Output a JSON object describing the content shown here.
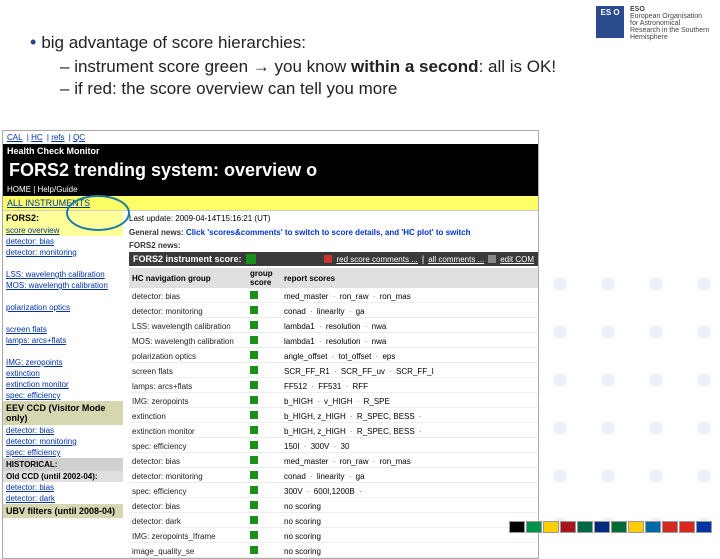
{
  "logo": {
    "badge": "ES O",
    "org": "ESO",
    "tag": "European Organisation for Astronomical Research in the Southern Hemisphere"
  },
  "bullets": {
    "l1": "big advantage of score hierarchies:",
    "l2a_pre": "instrument score green ",
    "l2a_arrow": "→",
    "l2a_mid": " you know ",
    "l2a_bold": "within a second",
    "l2a_post": ": all is OK!",
    "l2b": "if red: the score overview can tell you more"
  },
  "topnav": {
    "cal": "CAL",
    "hc": "HC",
    "refs": "refs",
    "qc": "QC"
  },
  "hc": {
    "left": "Health Check Monitor",
    "right": "ALL INSTRUMENTS"
  },
  "title": "FORS2 trending system: overview o",
  "home": "HOME | Help/Guide",
  "inline": "ALL INSTRUMENTS",
  "updated": "Last update: 2009-04-14T15:16:21 (UT)",
  "gnews_lbl": "General news:",
  "gnews_txt": "Click 'scores&comments' to switch to score details, and 'HC plot' to switch",
  "fnews": "FORS2 news:",
  "fis_lbl": "FORS2 instrument score:",
  "fis_a": "red score comments ...",
  "fis_b": "all comments ...",
  "fis_c": "edit COM",
  "thead": {
    "nav": "HC navigation group",
    "gs": "group score",
    "rs": "report scores"
  },
  "sidebar": {
    "fors2": "FORS2:",
    "score": "score overview",
    "items": [
      "detector: bias",
      "detector: monitoring",
      "",
      "LSS: wavelength calibration",
      "MOS: wavelength calibration",
      "",
      "polarization optics",
      "",
      "screen flats",
      "lamps: arcs+flats",
      "",
      "IMG: zeropoints",
      "extinction",
      "extinction monitor",
      "spec: efficiency"
    ],
    "eev": "EEV CCD (Visitor Mode only)",
    "eev_items": [
      "detector: bias",
      "detector: monitoring",
      "spec: efficiency"
    ],
    "hist": "HISTORICAL:",
    "old": "Old CCD (until 2002-04):",
    "old_items": [
      "detector: bias",
      "detector: dark"
    ],
    "ubv": "UBV filters (until 2008-04)"
  },
  "rows": [
    {
      "n": "detector: bias",
      "r": "med_master  ·  ron_raw  ·  ron_mas"
    },
    {
      "n": "detector: monitoring",
      "r": "conad  ·  linearity  ·  ga"
    },
    {
      "n": "LSS: wavelength calibration",
      "r": "lambda1  ·  resolution  ·  nwa"
    },
    {
      "n": "MOS: wavelength calibration",
      "r": "lambda1  ·  resolution  ·  nwa"
    },
    {
      "n": "polarization optics",
      "r": "angle_offset  ·  tot_offset  ·  eps"
    },
    {
      "n": "screen flats",
      "r": "SCR_FF_R1  ·  SCR_FF_uv  ·  SCR_FF_I"
    },
    {
      "n": "lamps: arcs+flats",
      "r": "FF512  ·  FF531  ·  RFF"
    },
    {
      "n": "IMG: zeropoints",
      "r": "b_HIGH  ·  v_HIGH  ·  R_SPE"
    },
    {
      "n": "extinction",
      "r": "b_HIGH, z_HIGH · R_SPEC, BESS ·"
    },
    {
      "n": "extinction monitor",
      "r": "b_HIGH, z_HIGH · R_SPEC, BESS ·"
    },
    {
      "n": "spec: efficiency",
      "r": "150I  ·  300V  ·  30"
    },
    {
      "n": "detector: bias",
      "r": "med_master  ·  ron_raw  ·  ron_mas"
    },
    {
      "n": "detector: monitoring",
      "r": "conad  ·  linearity  ·  ga"
    },
    {
      "n": "spec: efficiency",
      "r": "300V  ·  600I,1200B ·"
    },
    {
      "n": "detector: bias",
      "r": "no scoring"
    },
    {
      "n": "detector: dark",
      "r": "no scoring"
    },
    {
      "n": "IMG: zeropoints_Iframe",
      "r": "no scoring"
    },
    {
      "n": "image_quality_se",
      "r": "no scoring"
    }
  ],
  "flag_colors": [
    "#000",
    "#009246",
    "#ffce00",
    "#aa151b",
    "#006847",
    "#002b7f",
    "#046a38",
    "#ffcd00",
    "#006aa7",
    "#d52b1e",
    "#da291c",
    "#0033a0"
  ]
}
